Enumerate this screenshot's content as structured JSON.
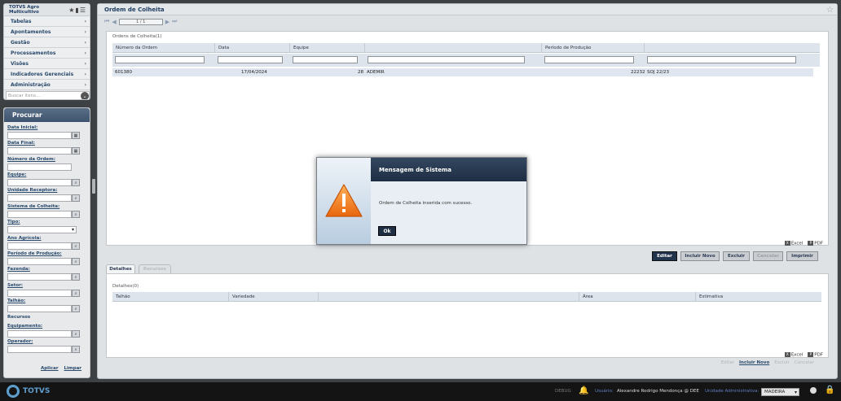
{
  "sidebar": {
    "brand": "TOTVS Agro Multicultivo",
    "menu_items": [
      "Tabelas",
      "Apontamentos",
      "Gestão",
      "Processamentos",
      "Visões",
      "Indicadores Gerenciais",
      "Administração"
    ],
    "search_placeholder": "Buscar itens...",
    "filter_title": "Procurar",
    "filters": {
      "data_inicial": "Data Inicial:",
      "data_final": "Data Final:",
      "numero_ordem": "Número da Ordem:",
      "equipe": "Equipe:",
      "unidade_receptora": "Unidade Receptora:",
      "sistema_colheita": "Sistema de Colheita:",
      "tipo": "Tipo:",
      "ano_agricola": "Ano Agrícola:",
      "periodo_producao": "Período de Produção:",
      "fazenda": "Fazenda:",
      "setor": "Setor:",
      "talhao": "Talhão:",
      "recursos": "Recursos",
      "equipamento": "Equipamento:",
      "operador": "Operador:"
    },
    "apply": "Aplicar",
    "clear": "Limpar"
  },
  "main": {
    "title": "Ordem de Colheita",
    "pager": "1 / 1",
    "grid_title": "Ordens de Colheita(1)",
    "columns": [
      "Número da Ordem",
      "Data",
      "Equipe",
      "",
      "Período de Produção",
      ""
    ],
    "row": {
      "ordem": "601380",
      "data": "17/04/2024",
      "equipe_cod": "28",
      "equipe": "ADEMIR",
      "periodo_cod": "22232",
      "periodo": "SOJ 22/23"
    },
    "export": {
      "excel": "Excel",
      "pdf": "PDF"
    },
    "buttons": {
      "editar": "Editar",
      "incluir_novo": "Incluir Novo",
      "excluir": "Excluir",
      "cancelar": "Cancelar",
      "imprimir": "Imprimir"
    },
    "tabs": {
      "detalhes": "Detalhes",
      "recursos": "Recursos"
    },
    "details_title": "Detalhes(0)",
    "detail_columns": [
      "Talhão",
      "Variedade",
      "",
      "Área",
      "Estimativa"
    ],
    "bottom_links": {
      "salvar": "Editar",
      "incluir": "Incluir Novo",
      "excluir": "Excluir",
      "cancelar": "Cancelar"
    }
  },
  "dialog": {
    "title": "Mensagem de Sistema",
    "message": "Ordem de Colheita inserida com sucesso.",
    "ok": "Ok"
  },
  "footer": {
    "brand": "TOTVS",
    "debug": "DEBUG",
    "user_label": "Usuário:",
    "user": "Alexandre Rodrigo Mendonça @ DEE",
    "unit_label": "Unidade Administrativa:",
    "unit": "MADEIRA"
  }
}
